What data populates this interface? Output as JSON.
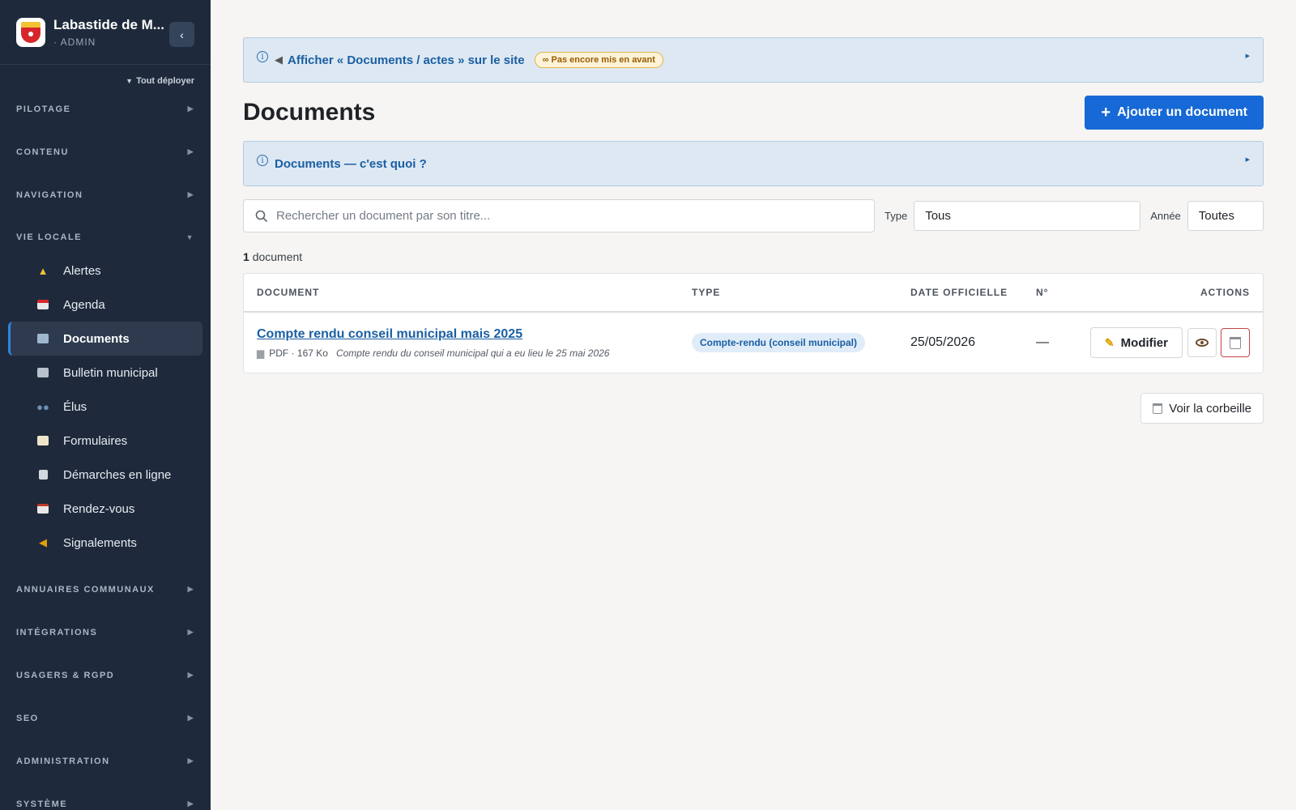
{
  "sidebar": {
    "brand_name": "Labastide de M...",
    "brand_role": "· ADMIN",
    "expand_all": "Tout déployer",
    "sections_top": [
      {
        "label": "PILOTAGE"
      },
      {
        "label": "CONTENU"
      },
      {
        "label": "NAVIGATION"
      }
    ],
    "open_section": "VIE LOCALE",
    "items": [
      {
        "label": "Alertes",
        "icon": "warning-icon"
      },
      {
        "label": "Agenda",
        "icon": "calendar-icon"
      },
      {
        "label": "Documents",
        "icon": "folder-icon"
      },
      {
        "label": "Bulletin municipal",
        "icon": "newspaper-icon"
      },
      {
        "label": "Élus",
        "icon": "people-icon"
      },
      {
        "label": "Formulaires",
        "icon": "memo-icon"
      },
      {
        "label": "Démarches en ligne",
        "icon": "receipt-icon"
      },
      {
        "label": "Rendez-vous",
        "icon": "calendar-pad-icon"
      },
      {
        "label": "Signalements",
        "icon": "megaphone-icon"
      }
    ],
    "sections_bottom": [
      {
        "label": "ANNUAIRES COMMUNAUX"
      },
      {
        "label": "INTÉGRATIONS"
      },
      {
        "label": "USAGERS & RGPD"
      },
      {
        "label": "SEO"
      },
      {
        "label": "ADMINISTRATION"
      },
      {
        "label": "SYSTÈME"
      }
    ]
  },
  "banner_display": {
    "title": "Afficher « Documents / actes » sur le site",
    "status": "Pas encore mis en avant"
  },
  "page": {
    "title": "Documents",
    "add_button": "Ajouter un document"
  },
  "banner_help": {
    "title": "Documents — c'est quoi ?"
  },
  "filters": {
    "search_placeholder": "Rechercher un document par son titre...",
    "type_label": "Type",
    "type_value": "Tous",
    "year_label": "Année",
    "year_value": "Toutes"
  },
  "count": {
    "number": "1",
    "label": "document"
  },
  "table": {
    "headers": {
      "document": "DOCUMENT",
      "type": "TYPE",
      "date": "DATE OFFICIELLE",
      "num": "N°",
      "actions": "ACTIONS"
    },
    "rows": [
      {
        "title": "Compte rendu conseil municipal mais 2025",
        "format": "PDF · 167 Ko",
        "description": "Compte rendu du conseil municipal qui a eu lieu le 25 mai 2026",
        "type": "Compte-rendu (conseil municipal)",
        "date": "25/05/2026",
        "num": "—",
        "edit_label": "Modifier"
      }
    ]
  },
  "trash_button": "Voir la corbeille",
  "colors": {
    "sidebar_bg": "#1e2a3b",
    "accent": "#1669d6",
    "link": "#1a5fa3",
    "banner_bg": "#dde8f3"
  }
}
